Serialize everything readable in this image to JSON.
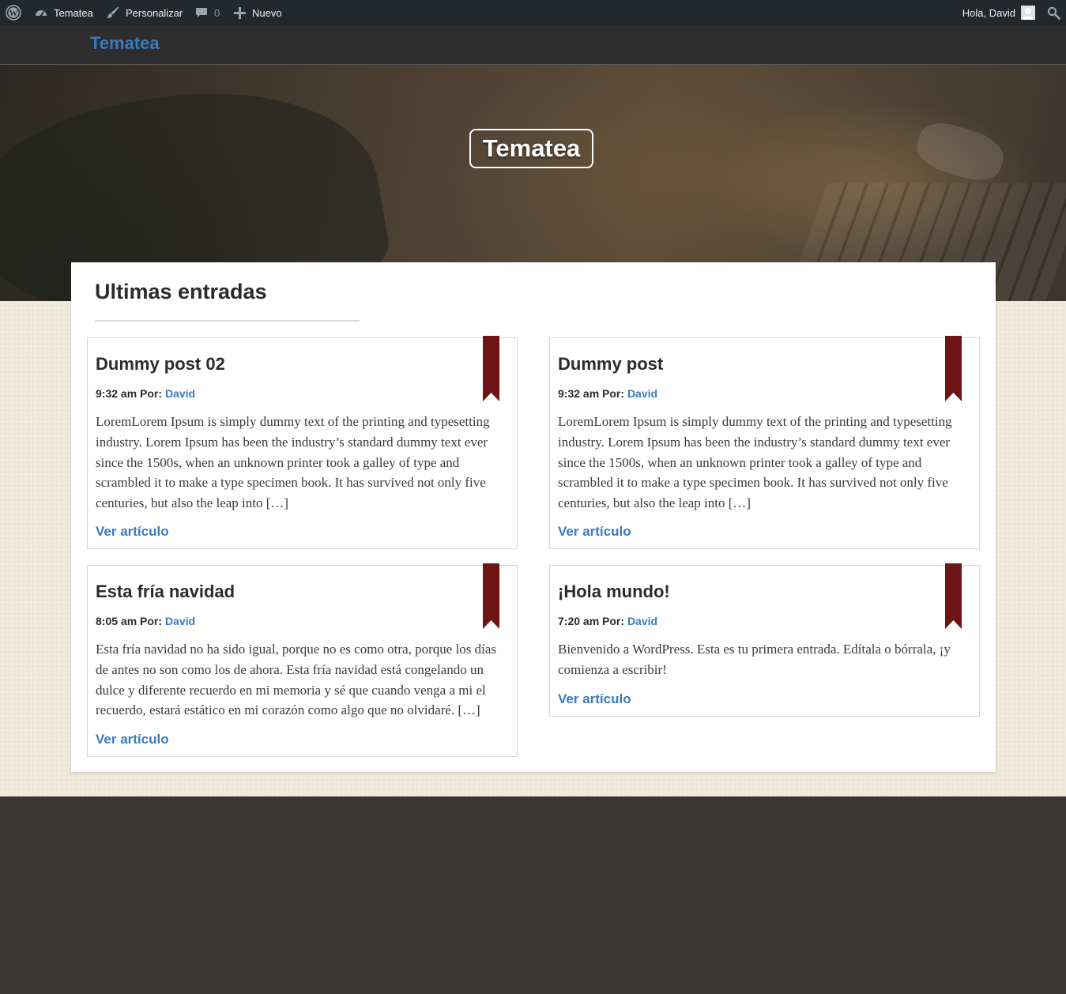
{
  "admin_bar": {
    "site_name": "Tematea",
    "customize_label": "Personalizar",
    "comments_count": "0",
    "new_label": "Nuevo",
    "greeting": "Hola, David"
  },
  "header": {
    "site_title": "Tematea"
  },
  "hero": {
    "title": "Tematea"
  },
  "main": {
    "heading": "Ultimas entradas"
  },
  "posts": [
    {
      "title": "Dummy post 02",
      "time": "9:32 am",
      "by_label": "Por:",
      "author": "David",
      "excerpt": "LoremLorem Ipsum is simply dummy text of the printing and typesetting industry. Lorem Ipsum has been the industry’s standard dummy text ever since the 1500s, when an unknown printer took a galley of type and scrambled it to make a type specimen book. It has survived not only five centuries, but also the leap into […]",
      "link_label": "Ver artículo"
    },
    {
      "title": "Dummy post",
      "time": "9:32 am",
      "by_label": "Por:",
      "author": "David",
      "excerpt": "LoremLorem Ipsum is simply dummy text of the printing and typesetting industry. Lorem Ipsum has been the industry’s standard dummy text ever since the 1500s, when an unknown printer took a galley of type and scrambled it to make a type specimen book. It has survived not only five centuries, but also the leap into […]",
      "link_label": "Ver artículo"
    },
    {
      "title": "Esta fría navidad",
      "time": "8:05 am",
      "by_label": "Por:",
      "author": "David",
      "excerpt": "Esta fría navidad no ha sido igual, porque no es como otra, porque los días de antes no son como los de ahora. Esta fría navidad está congelando un dulce y diferente recuerdo en mi memoria y sé que cuando venga a mi el recuerdo, estará estático en mi corazón como algo que no olvidaré. […]",
      "link_label": "Ver artículo"
    },
    {
      "title": "¡Hola mundo!",
      "time": "7:20 am",
      "by_label": "Por:",
      "author": "David",
      "excerpt": "Bienvenido a WordPress. Esta es tu primera entrada. Edítala o bórrala, ¡y comienza a escribir!",
      "link_label": "Ver artículo"
    }
  ],
  "colors": {
    "link_blue": "#3a7bbf",
    "ribbon_red": "#6e1414",
    "admin_bar_bg": "#23282d",
    "header_bg": "#2d2d2d",
    "band_beige": "#efe9da",
    "footer_bg": "#373633"
  },
  "icons": {
    "wordpress": "wordpress-logo-icon",
    "dashboard": "dashboard-icon",
    "customize": "brush-icon",
    "comments": "comment-bubble-icon",
    "new": "plus-icon",
    "avatar": "avatar-icon",
    "search": "search-icon",
    "ribbon": "bookmark-ribbon-icon"
  }
}
